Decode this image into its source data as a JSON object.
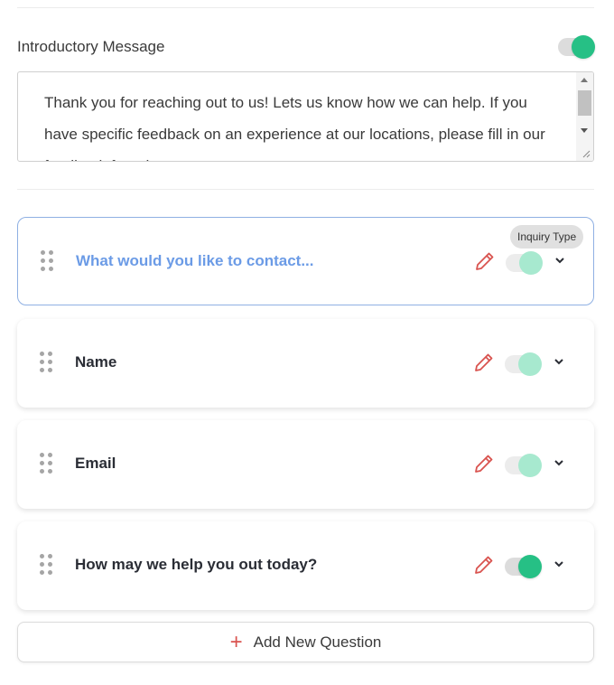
{
  "intro": {
    "label": "Introductory Message",
    "enabled": true,
    "message": "Thank you for reaching out to us! Lets us know how we can help. If you have specific feedback on an experience at our locations, please fill in our feedback form here."
  },
  "questions": [
    {
      "title": "What would you like to contact...",
      "tag": "Inquiry Type",
      "enabled": true,
      "state": "active"
    },
    {
      "title": "Name",
      "enabled": true,
      "state": "locked"
    },
    {
      "title": "Email",
      "enabled": true,
      "state": "locked"
    },
    {
      "title": "How may we help you out today?",
      "enabled": true,
      "state": "normal"
    }
  ],
  "add_button": {
    "label": "Add New Question",
    "icon": "plus-icon"
  },
  "colors": {
    "toggle_on": "#26c085",
    "toggle_locked": "#a7e9cf",
    "active_border": "#8fb0e3",
    "active_title": "#6b9be6",
    "edit_icon": "#d9534f"
  }
}
